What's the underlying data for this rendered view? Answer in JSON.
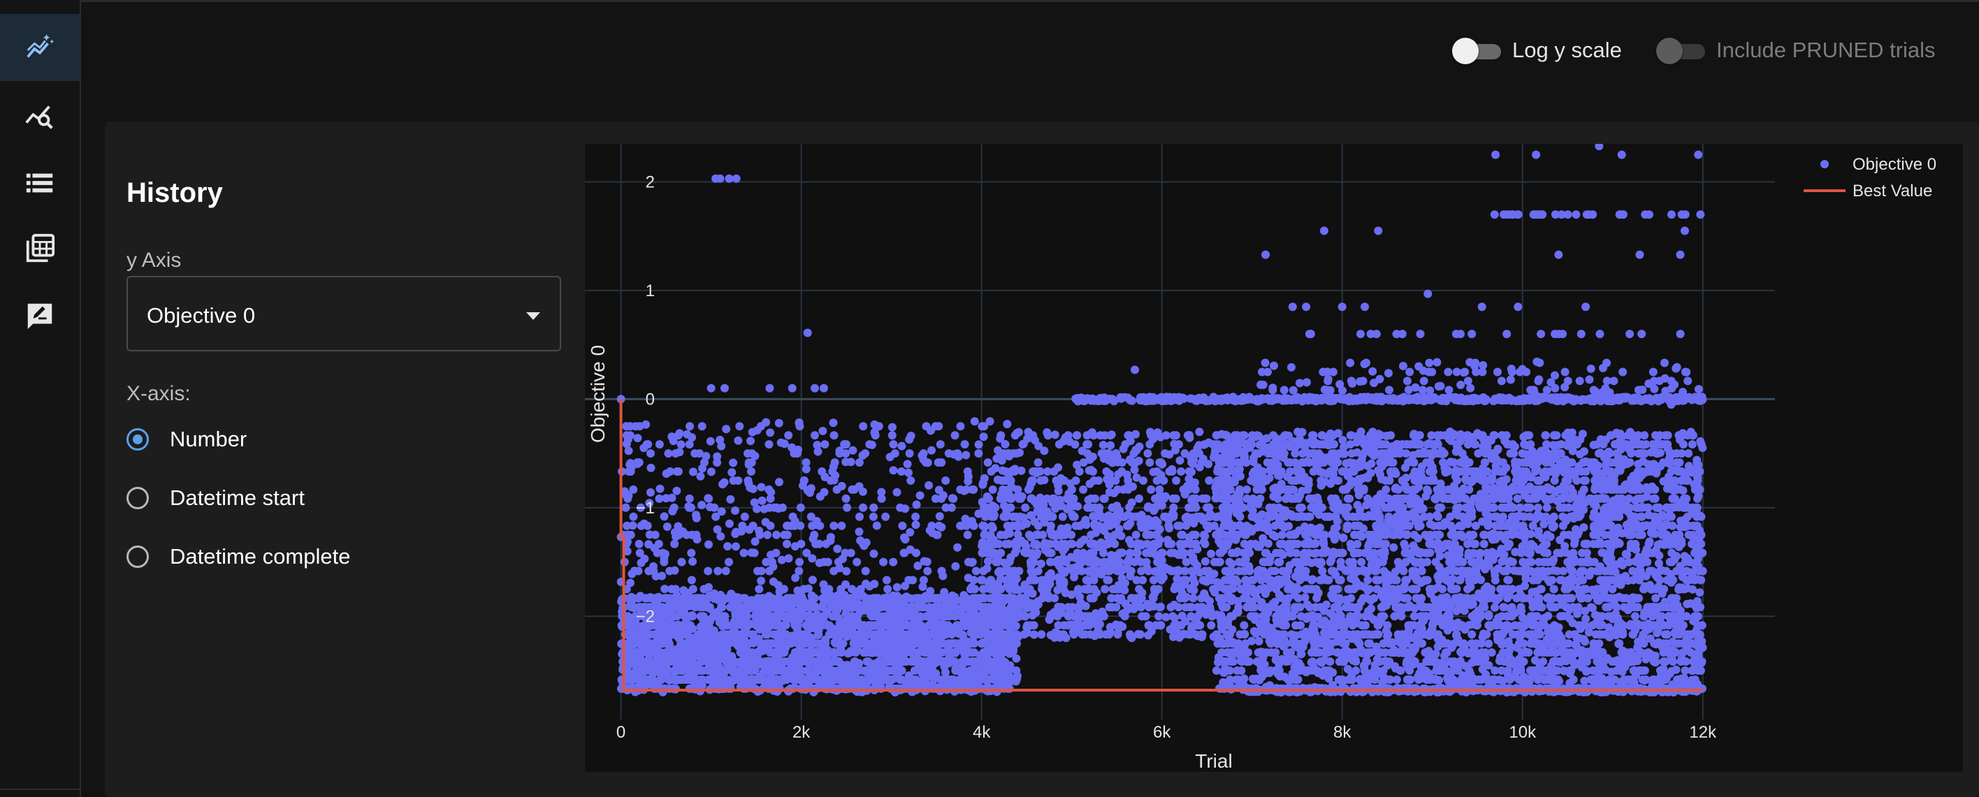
{
  "sidebar": {
    "items": [
      {
        "name": "history-icon",
        "active": true
      },
      {
        "name": "analytics-icon",
        "active": false
      },
      {
        "name": "list-icon",
        "active": false
      },
      {
        "name": "table-icon",
        "active": false
      },
      {
        "name": "note-icon",
        "active": false
      }
    ]
  },
  "header": {
    "log_y_scale_label": "Log y scale",
    "log_y_scale_on": false,
    "include_pruned_label": "Include PRUNED trials",
    "include_pruned_on": false,
    "include_pruned_disabled": true
  },
  "panel": {
    "title": "History",
    "y_axis_label": "y Axis",
    "y_axis_value": "Objective 0",
    "x_axis_label": "X-axis:",
    "x_axis_options": [
      {
        "label": "Number",
        "checked": true
      },
      {
        "label": "Datetime start",
        "checked": false
      },
      {
        "label": "Datetime complete",
        "checked": false
      }
    ]
  },
  "colors": {
    "points": "#6b6ef2",
    "best_line": "#e0553f",
    "accent": "#5aa0ea"
  },
  "chart_data": {
    "type": "scatter",
    "title": "",
    "xlabel": "Trial",
    "ylabel": "Objective 0",
    "xlim": [
      -400,
      12800
    ],
    "ylim": [
      -2.95,
      2.35
    ],
    "x_ticks": [
      0,
      2000,
      4000,
      6000,
      8000,
      10000,
      12000
    ],
    "x_tick_labels": [
      "0",
      "2k",
      "4k",
      "6k",
      "8k",
      "10k",
      "12k"
    ],
    "y_ticks": [
      2,
      1,
      0,
      -1,
      -2
    ],
    "y_tick_labels": [
      "2",
      "1",
      "0",
      "−1",
      "−2"
    ],
    "grid": true,
    "legend": {
      "placement": "top-right",
      "entries": [
        "Objective 0",
        "Best Value"
      ]
    },
    "series": [
      {
        "name": "Objective 0",
        "mode": "markers",
        "cluster_note": "dense point cloud; bands listed as [x_start, x_end, y_low, y_high, count]",
        "clusters": [
          [
            0,
            4400,
            -2.7,
            -1.8,
            2600
          ],
          [
            0,
            4400,
            -1.8,
            -0.2,
            550
          ],
          [
            4000,
            6600,
            -2.2,
            -0.9,
            900
          ],
          [
            4200,
            6800,
            -0.9,
            -0.3,
            250
          ],
          [
            6600,
            12000,
            -2.7,
            -0.3,
            4200
          ],
          [
            5000,
            12000,
            -0.02,
            0.02,
            520
          ],
          [
            7000,
            12000,
            0.05,
            0.35,
            120
          ],
          [
            6900,
            12000,
            -2.7,
            -2.66,
            300
          ]
        ],
        "points": [
          {
            "x": 1050,
            "y": 2.03
          },
          {
            "x": 1100,
            "y": 2.03
          },
          {
            "x": 1200,
            "y": 2.03
          },
          {
            "x": 1280,
            "y": 2.03
          },
          {
            "x": 2070,
            "y": 0.61
          },
          {
            "x": 1000,
            "y": 0.1
          },
          {
            "x": 1150,
            "y": 0.1
          },
          {
            "x": 1650,
            "y": 0.1
          },
          {
            "x": 1900,
            "y": 0.1
          },
          {
            "x": 2150,
            "y": 0.1
          },
          {
            "x": 2250,
            "y": 0.1
          },
          {
            "x": 5700,
            "y": 0.27
          },
          {
            "x": 7150,
            "y": 1.33
          },
          {
            "x": 7800,
            "y": 1.55
          },
          {
            "x": 8400,
            "y": 1.55
          },
          {
            "x": 8950,
            "y": 0.97
          },
          {
            "x": 9700,
            "y": 2.25
          },
          {
            "x": 10150,
            "y": 2.25
          },
          {
            "x": 10850,
            "y": 2.33
          },
          {
            "x": 11100,
            "y": 2.25
          },
          {
            "x": 11950,
            "y": 2.25
          },
          {
            "x": 10400,
            "y": 1.33
          },
          {
            "x": 11300,
            "y": 1.33
          },
          {
            "x": 11750,
            "y": 1.33
          },
          {
            "x": 11800,
            "y": 1.55
          },
          {
            "x": 10700,
            "y": 0.85
          },
          {
            "x": 7450,
            "y": 0.85
          },
          {
            "x": 7600,
            "y": 0.85
          },
          {
            "x": 8000,
            "y": 0.85
          },
          {
            "x": 8250,
            "y": 0.85
          },
          {
            "x": 9550,
            "y": 0.85
          },
          {
            "x": 9950,
            "y": 0.85
          },
          {
            "x": 0,
            "y": 0.0
          },
          {
            "x": 0,
            "y": -1.27
          },
          {
            "x": 40,
            "y": -0.85
          },
          {
            "x": 3100,
            "y": -2.68
          },
          {
            "x": 2600,
            "y": -2.68
          },
          {
            "x": 3850,
            "y": -2.68
          },
          {
            "x": 4050,
            "y": -2.68
          },
          {
            "x": 11650,
            "y": -0.05
          }
        ],
        "band_1_7": {
          "x_from": 9600,
          "x_to": 12000,
          "y": 1.7,
          "count": 30
        },
        "band_0_6": {
          "x_from": 7200,
          "x_to": 12000,
          "y": 0.6,
          "count": 22
        }
      },
      {
        "name": "Best Value",
        "mode": "lines",
        "x": [
          0,
          0,
          30,
          30,
          12000
        ],
        "y": [
          0.0,
          -1.27,
          -1.27,
          -2.68,
          -2.68
        ]
      }
    ]
  }
}
